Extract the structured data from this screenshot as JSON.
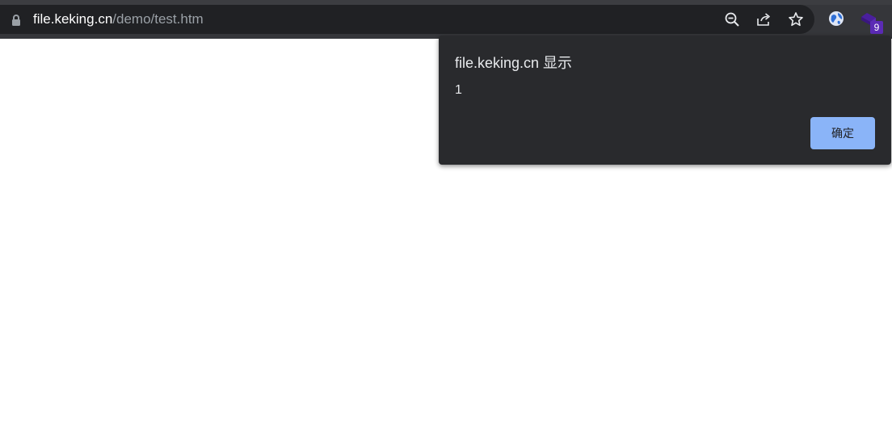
{
  "browser": {
    "url_host": "file.keking.cn",
    "url_path": "/demo/test.htm",
    "extension_badge": "9",
    "icons": {
      "lock": "lock-icon",
      "zoom": "zoom-out-icon",
      "share": "share-icon",
      "bookmark": "star-icon",
      "extension_globe": "globe-icon",
      "extension_cube": "cube-icon"
    }
  },
  "dialog": {
    "title": "file.keking.cn 显示",
    "message": "1",
    "ok_label": "确定"
  },
  "colors": {
    "toolbar": "#35363a",
    "omnibox": "#202124",
    "dialog_bg": "#292a2d",
    "ok_button": "#8ab4f8",
    "badge": "#5b2bb5"
  }
}
